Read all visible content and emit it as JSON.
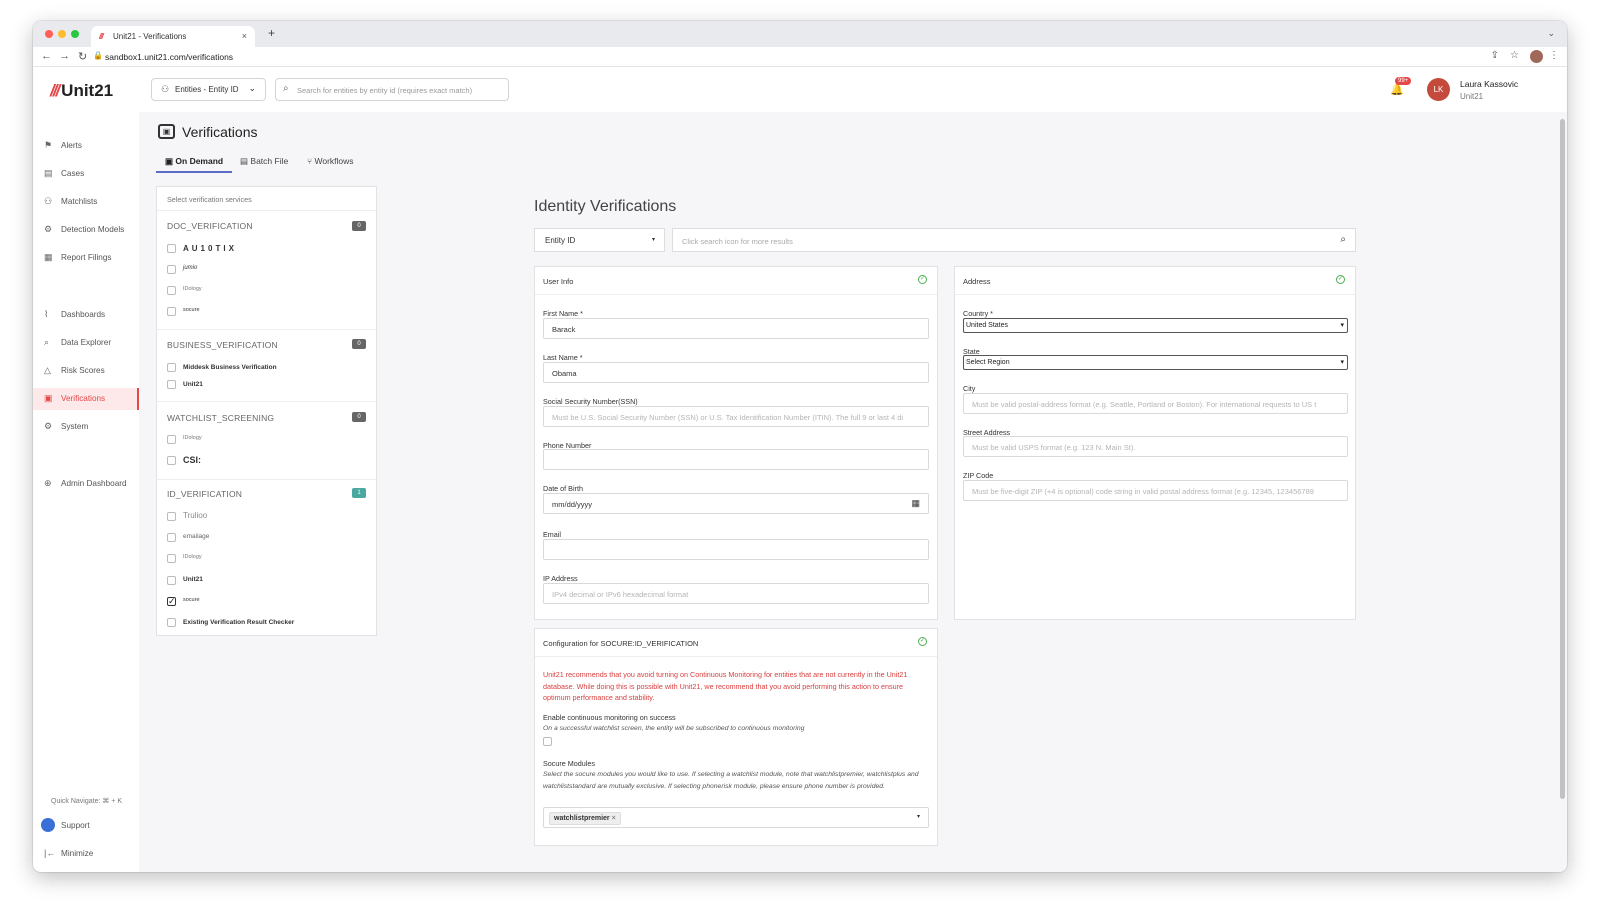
{
  "browser": {
    "tab_title": "Unit21 - Verifications",
    "tab_logo": "///",
    "close_glyph": "×",
    "newtab_glyph": "+",
    "tabdrop_glyph": "⌄",
    "back_glyph": "←",
    "forward_glyph": "→",
    "reload_glyph": "↻",
    "lock_glyph": "🔒",
    "share_glyph": "⇪",
    "star_glyph": "☆",
    "menu_glyph": "⋮",
    "url": "sandbox1.unit21.com/verifications"
  },
  "colors": {
    "accent": "#e54848",
    "tab_underline": "#5b6bc7",
    "success": "#4caf50",
    "warning_text": "#d94040"
  },
  "logo": {
    "slash": "///",
    "text": "Unit21"
  },
  "sidebar": {
    "items": [
      {
        "label": "Alerts",
        "icon": "⚑"
      },
      {
        "label": "Cases",
        "icon": "▤"
      },
      {
        "label": "Matchlists",
        "icon": "⚇"
      },
      {
        "label": "Detection Models",
        "icon": "⚙"
      },
      {
        "label": "Report Filings",
        "icon": "▦"
      },
      {
        "label": "Dashboards",
        "icon": "⌇"
      },
      {
        "label": "Data Explorer",
        "icon": "⌕"
      },
      {
        "label": "Risk Scores",
        "icon": "△"
      },
      {
        "label": "Verifications",
        "icon": "▣"
      },
      {
        "label": "System",
        "icon": "⚙"
      },
      {
        "label": "Admin Dashboard",
        "icon": "⊕"
      }
    ],
    "quick_navigate": "Quick Navigate: ⌘ + K",
    "support": "Support",
    "minimize": "Minimize",
    "minimize_icon": "|←"
  },
  "topbar": {
    "entity_selector": "Entities - Entity ID",
    "entity_icon": "⚇",
    "chevron": "⌄",
    "search_placeholder": "Search for entities by entity id (requires exact match)",
    "search_icon": "⌕",
    "bell_icon": "🔔",
    "notification_badge": "99+",
    "user_initials": "LK",
    "user_name": "Laura Kassovic",
    "user_org": "Unit21"
  },
  "page": {
    "title": "Verifications",
    "title_icon": "▣",
    "tabs": [
      {
        "label": "On Demand",
        "icon": "▣"
      },
      {
        "label": "Batch File",
        "icon": "▤"
      },
      {
        "label": "Workflows",
        "icon": "⑂"
      }
    ]
  },
  "services": {
    "header": "Select verification services",
    "groups": [
      {
        "name": "DOC_VERIFICATION",
        "count": "0",
        "items": [
          {
            "label": "AU10TIX",
            "checked": false
          },
          {
            "label": "jumio",
            "checked": false
          },
          {
            "label": "IDology",
            "checked": false
          },
          {
            "label": "socure",
            "checked": false
          }
        ]
      },
      {
        "name": "BUSINESS_VERIFICATION",
        "count": "0",
        "items": [
          {
            "label": "Middesk Business Verification",
            "checked": false
          },
          {
            "label": "Unit21",
            "checked": false
          }
        ]
      },
      {
        "name": "WATCHLIST_SCREENING",
        "count": "0",
        "items": [
          {
            "label": "IDology",
            "checked": false
          },
          {
            "label": "CSI:",
            "checked": false
          }
        ]
      },
      {
        "name": "ID_VERIFICATION",
        "count": "1",
        "items": [
          {
            "label": "Trulioo",
            "checked": false
          },
          {
            "label": "emailage",
            "checked": false
          },
          {
            "label": "IDology",
            "checked": false
          },
          {
            "label": "Unit21",
            "checked": false
          },
          {
            "label": "socure",
            "checked": true
          },
          {
            "label": "Existing Verification Result Checker",
            "checked": false
          }
        ]
      }
    ]
  },
  "identity": {
    "title": "Identity Verifications",
    "lookup_type": "Entity ID",
    "lookup_placeholder": "Click search icon for more results",
    "user_info": {
      "title": "User Info",
      "first_name_label": "First Name *",
      "first_name": "Barack",
      "last_name_label": "Last Name *",
      "last_name": "Obama",
      "ssn_label": "Social Security Number(SSN)",
      "ssn_placeholder": "Must be U.S. Social Security Number (SSN) or U.S. Tax Identification Number (ITIN). The full 9 or last 4 di",
      "phone_label": "Phone Number",
      "phone": "",
      "dob_label": "Date of Birth",
      "dob_placeholder": "mm/dd/yyyy",
      "email_label": "Email",
      "email": "",
      "ip_label": "IP Address",
      "ip_placeholder": "IPv4 decimal or IPv6 hexadecimal format"
    },
    "address": {
      "title": "Address",
      "country_label": "Country *",
      "country": "United States",
      "state_label": "State",
      "state": "Select Region",
      "city_label": "City",
      "city_placeholder": "Must be valid postal-address format (e.g. Seattle, Portland or Boston). For international requests to US t",
      "street_label": "Street Address",
      "street_placeholder": "Must be valid USPS format (e.g. 123 N. Main St).",
      "zip_label": "ZIP Code",
      "zip_placeholder": "Must be five-digit ZIP (+4 is optional) code string in valid postal address format (e.g. 12345, 123456789"
    },
    "config": {
      "title": "Configuration for SOCURE:ID_VERIFICATION",
      "warning": "Unit21 recommends that you avoid turning on Continuous Monitoring for entities that are not currently in the Unit21 database. While doing this is possible with Unit21, we recommend that you avoid performing this action to ensure optimum performance and stability.",
      "monitor_label": "Enable continuous monitoring on success",
      "monitor_help": "On a successful watchlist screen, the entity will be subscribed to continuous monitoring",
      "modules_label": "Socure Modules",
      "modules_help": "Select the socure modules you would like to use. If selecting a watchlist module, note that watchlistpremier, watchlistplus and watchliststandard are mutually exclusive. If selecting phonerisk module, please ensure phone number is provided.",
      "selected_module": "watchlistpremier"
    },
    "ok_glyph": "✓",
    "search_glyph": "⌕",
    "dropdown_glyph": "▾",
    "calendar_glyph": "▦",
    "chip_remove": "×",
    "check_glyph": "✓"
  }
}
